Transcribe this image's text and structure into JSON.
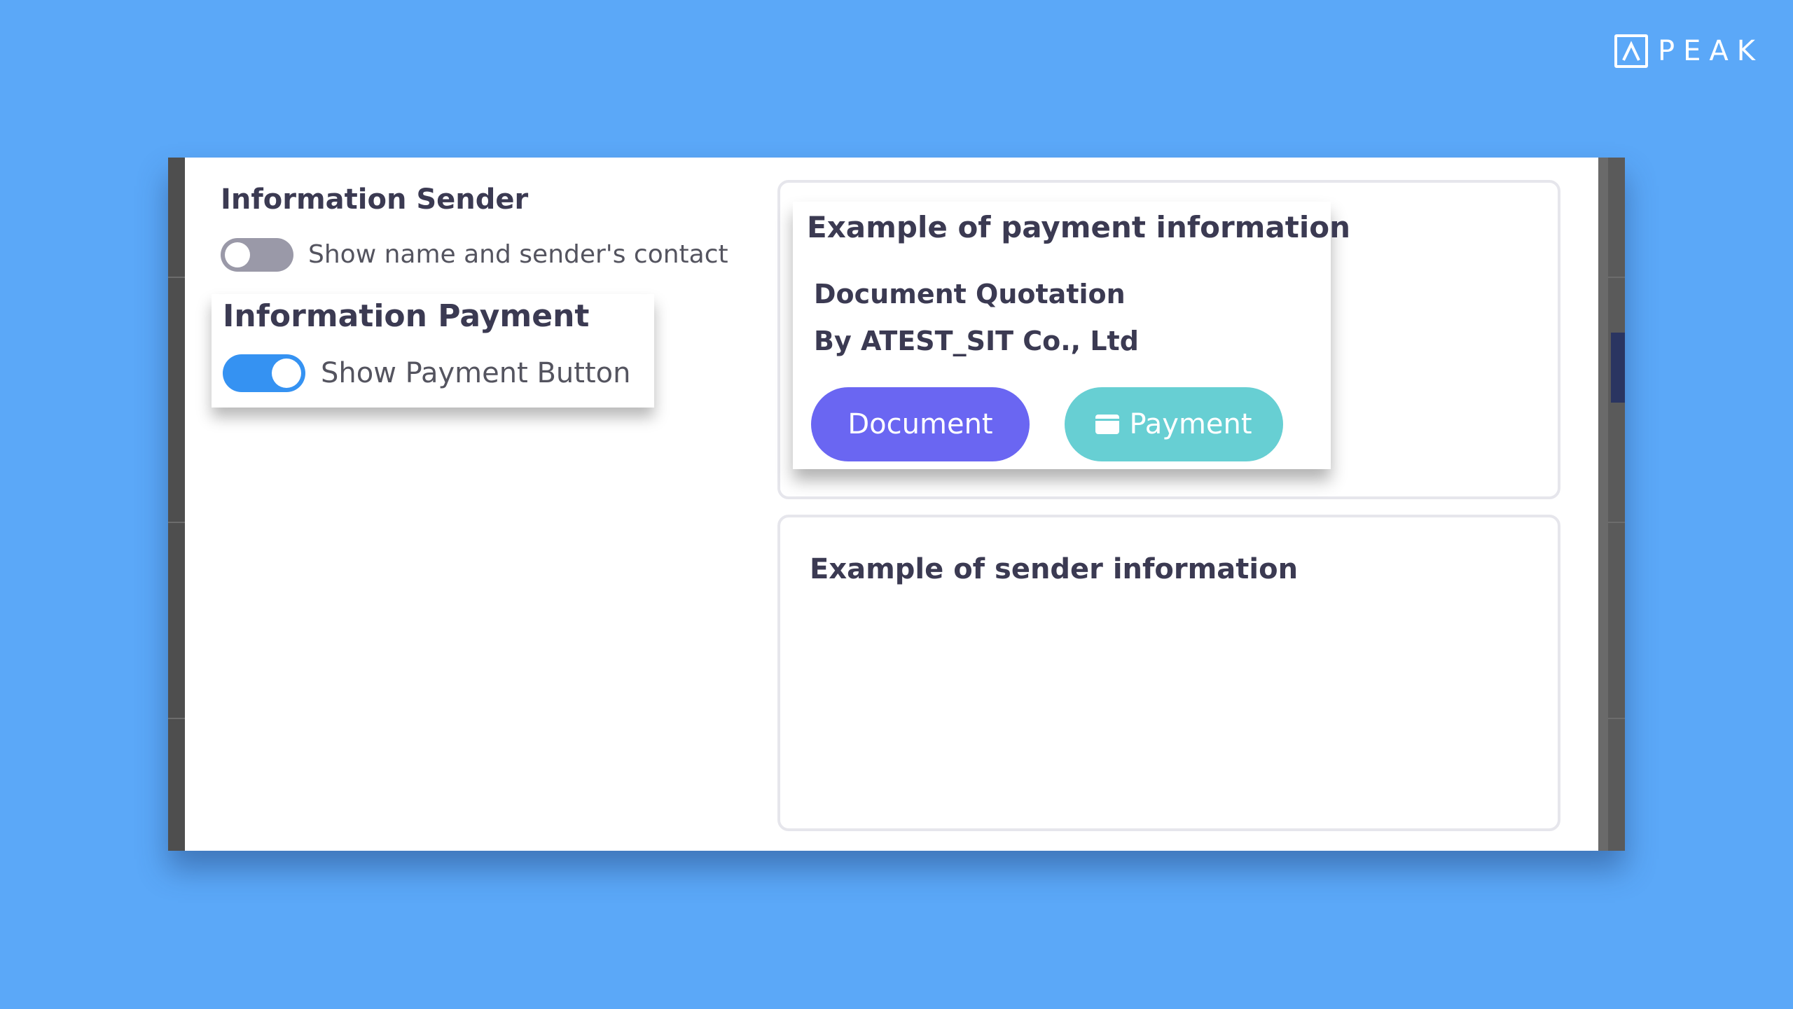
{
  "brand": {
    "name": "PEAK"
  },
  "settings": {
    "sender_title": "Information Sender",
    "sender_toggle_label": "Show name and sender's contact",
    "sender_toggle_on": false,
    "payment_title": "Information Payment",
    "payment_toggle_label": "Show Payment Button",
    "payment_toggle_on": true
  },
  "payment_example": {
    "title": "Example of payment information",
    "line1": "Document Quotation",
    "line2": "By ATEST_SIT Co., Ltd",
    "document_button": "Document",
    "payment_button": "Payment"
  },
  "sender_example": {
    "title": "Example of sender information"
  },
  "colors": {
    "background": "#5ba8f8",
    "toggle_on": "#3592f2",
    "toggle_off": "#9a99a8",
    "document_button": "#6a66f2",
    "payment_button": "#67cfd3"
  },
  "icons": {
    "logo": "peak-logo-icon",
    "payment_button_icon": "wallet-icon"
  }
}
